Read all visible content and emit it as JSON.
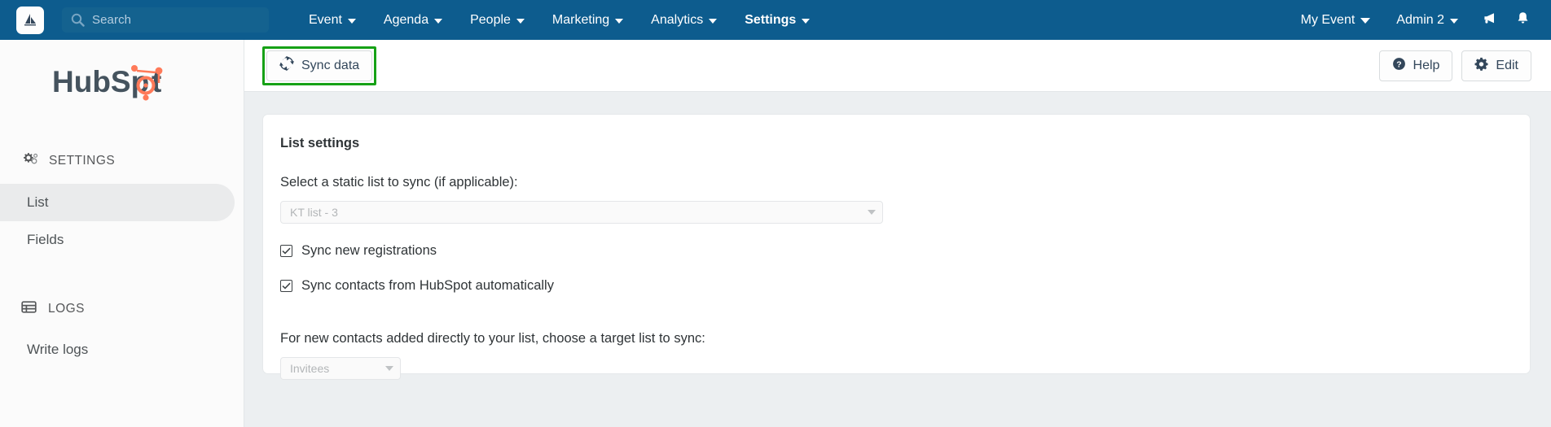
{
  "topnav": {
    "logo_icon": "app-logo-icon",
    "search": {
      "placeholder": "Search",
      "icon": "search-icon"
    },
    "items": [
      {
        "label": "Event",
        "active": false
      },
      {
        "label": "Agenda",
        "active": false
      },
      {
        "label": "People",
        "active": false
      },
      {
        "label": "Marketing",
        "active": false
      },
      {
        "label": "Analytics",
        "active": false
      },
      {
        "label": "Settings",
        "active": true
      }
    ],
    "right": {
      "event_menu": "My Event",
      "user_menu": "Admin 2",
      "announcements_icon": "megaphone-icon",
      "notifications_icon": "bell-icon"
    }
  },
  "sidebar": {
    "brand": "HubSpot",
    "sections": [
      {
        "label": "SETTINGS",
        "icon": "gear-icon",
        "items": [
          {
            "label": "List",
            "active": true
          },
          {
            "label": "Fields",
            "active": false
          }
        ]
      },
      {
        "label": "LOGS",
        "icon": "table-icon",
        "items": [
          {
            "label": "Write logs",
            "active": false
          }
        ]
      }
    ]
  },
  "toolbar": {
    "sync_label": "Sync data",
    "sync_icon": "sync-refresh-icon",
    "sync_highlighted": true,
    "help_label": "Help",
    "help_icon": "question-circle-icon",
    "edit_label": "Edit",
    "edit_icon": "gear-icon"
  },
  "card": {
    "title": "List settings",
    "static_list_label": "Select a static list to sync (if applicable):",
    "static_list_value": "KT list - 3",
    "checkbox_new_registrations": "Sync new registrations",
    "checkbox_auto_sync": "Sync contacts from HubSpot automatically",
    "target_list_label": "For new contacts added directly to your list, choose a target list to sync:",
    "target_list_value": "Invitees"
  },
  "colors": {
    "nav_blue": "#0d5c8e",
    "highlight_green": "#16a116",
    "page_bg": "#eceff1",
    "hubspot_orange": "#ff7a59",
    "hubspot_slate": "#45535e"
  }
}
